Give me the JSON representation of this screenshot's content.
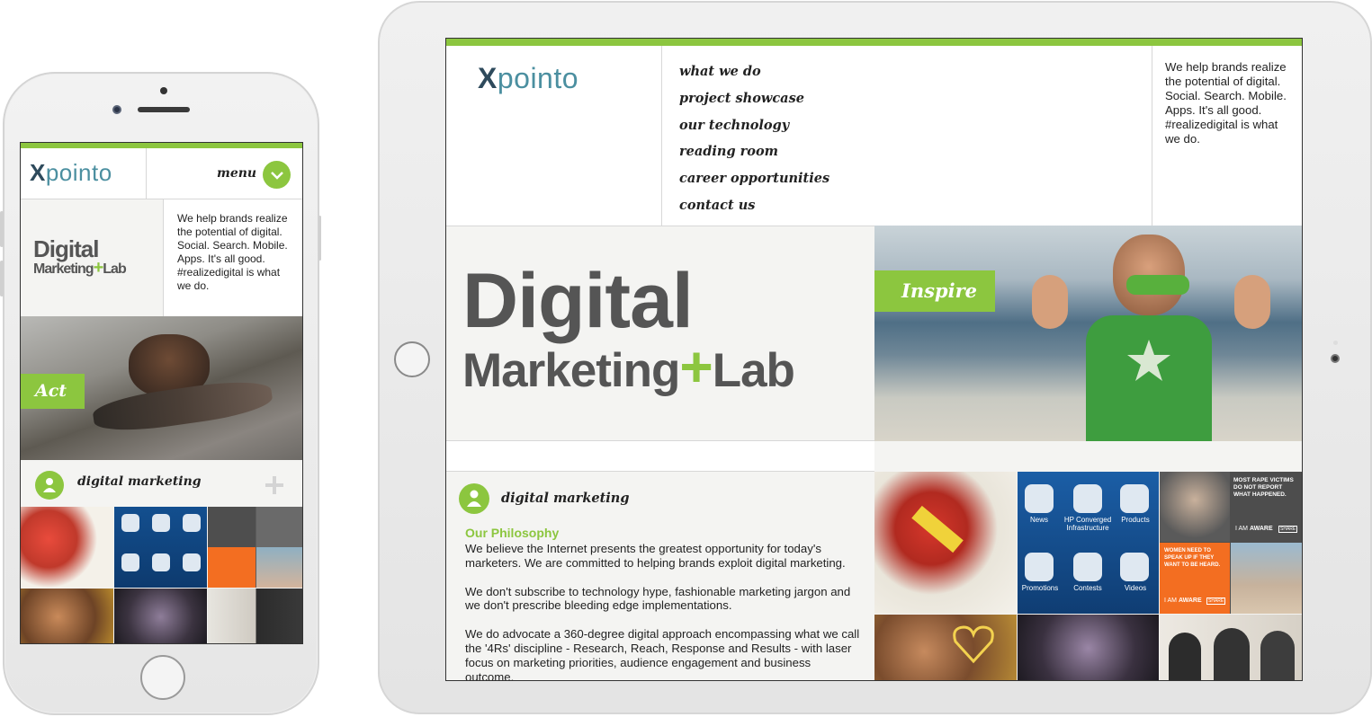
{
  "brand": {
    "logo_x": "X",
    "logo_rest": "pointo",
    "green": "#8cc63f"
  },
  "nav": {
    "items": [
      "what we do",
      "project showcase",
      "our technology",
      "reading room",
      "career opportunities",
      "contact us"
    ],
    "menu_label": "menu"
  },
  "intro_lines": [
    "We help brands realize",
    "the potential of digital.",
    "Social. Search. Mobile.",
    "Apps. It's all good.",
    "#realizedigital is what",
    "we do."
  ],
  "headline": {
    "line1": "Digital",
    "line2_a": "Marketing",
    "plus": "+",
    "line2_b": "Lab"
  },
  "hero": {
    "tablet_badge": "Inspire",
    "phone_badge": "Act"
  },
  "section": {
    "title": "digital marketing",
    "philosophy_heading": "Our Philosophy",
    "paragraphs": [
      "We believe the Internet presents the greatest opportunity for today's marketers. We are committed to helping brands exploit digital marketing.",
      "We don't subscribe to technology hype, fashionable marketing jargon and we don't prescribe bleeding edge implementations.",
      "We do advocate a 360-degree digital approach encompassing what we call the '4Rs' discipline - Research, Reach, Response and Results - with laser focus on marketing priorities, audience engagement and business outcome."
    ]
  },
  "app_tile": {
    "buttons": [
      "News",
      "HP Converged Infrastructure",
      "Products",
      "Promotions",
      "Contests",
      "Videos"
    ]
  },
  "aware_tile": {
    "headline_top": "MOST RAPE VICTIMS DO NOT REPORT WHAT HAPPENED.",
    "i_am": "I AM",
    "aware": "AWARE",
    "share": "SHARE",
    "orange_text": "WOMEN NEED TO SPEAK UP IF THEY WANT TO BE HEARD."
  }
}
